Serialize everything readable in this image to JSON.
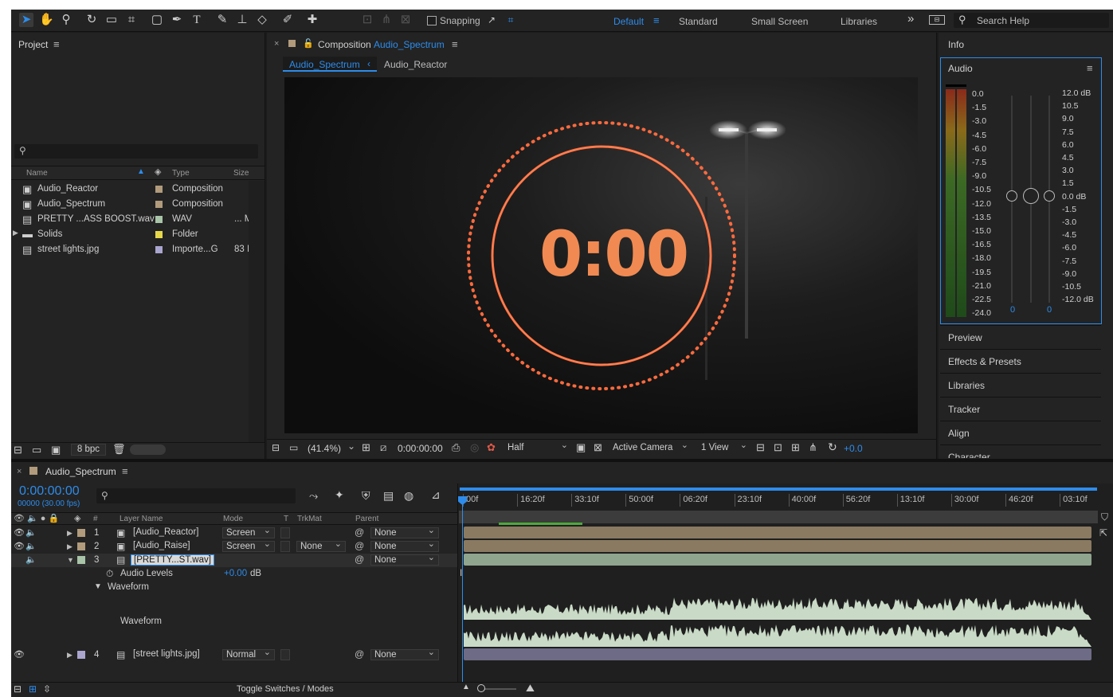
{
  "toolbar": {
    "snapping_label": "Snapping",
    "workspaces": [
      "Default",
      "Standard",
      "Small Screen",
      "Libraries"
    ],
    "active_workspace": "Default",
    "search_placeholder": "Search Help"
  },
  "project": {
    "title": "Project",
    "columns": {
      "name": "Name",
      "type": "Type",
      "size": "Size"
    },
    "items": [
      {
        "name": "Audio_Reactor",
        "type": "Composition",
        "size": "",
        "color": "#b19b7c",
        "icon": "composition-icon"
      },
      {
        "name": "Audio_Spectrum",
        "type": "Composition",
        "size": "",
        "color": "#b19b7c",
        "icon": "composition-icon"
      },
      {
        "name": "PRETTY ...ASS BOOST.wav",
        "type": "WAV",
        "size": "... M",
        "color": "#a9c4a8",
        "icon": "audio-file-icon"
      },
      {
        "name": "Solids",
        "type": "Folder",
        "size": "",
        "color": "#e6d84a",
        "icon": "folder-icon"
      },
      {
        "name": "street lights.jpg",
        "type": "Importe...G",
        "size": "83 I",
        "color": "#a9a5cf",
        "icon": "image-file-icon"
      }
    ],
    "bpc": "8 bpc"
  },
  "composition": {
    "panel_label": "Composition",
    "comp_name": "Audio_Spectrum",
    "breadcrumbs": [
      "Audio_Spectrum",
      "Audio_Reactor"
    ],
    "timer_text": "0:00",
    "zoom": "(41.4%)",
    "timecode": "0:00:00:00",
    "resolution": "Half",
    "camera": "Active Camera",
    "views": "1 View",
    "exposure": "+0.0"
  },
  "right_panel": {
    "info_label": "Info",
    "audio_label": "Audio",
    "left_scale": [
      "0.0",
      "-1.5",
      "-3.0",
      "-4.5",
      "-6.0",
      "-7.5",
      "-9.0",
      "-10.5",
      "-12.0",
      "-13.5",
      "-15.0",
      "-16.5",
      "-18.0",
      "-19.5",
      "-21.0",
      "-22.5",
      "-24.0"
    ],
    "right_scale": [
      "12.0 dB",
      "10.5",
      "9.0",
      "7.5",
      "6.0",
      "4.5",
      "3.0",
      "1.5",
      "0.0 dB",
      "-1.5",
      "-3.0",
      "-4.5",
      "-6.0",
      "-7.5",
      "-9.0",
      "-10.5",
      "-12.0 dB"
    ],
    "slider_left_value": "0",
    "slider_right_value": "0",
    "sections": [
      "Preview",
      "Effects & Presets",
      "Libraries",
      "Tracker",
      "Align",
      "Character"
    ]
  },
  "timeline": {
    "tab": "Audio_Spectrum",
    "timecode": "0:00:00:00",
    "frames": "00000 (30.00 fps)",
    "columns": {
      "num": "#",
      "layer_name": "Layer Name",
      "mode": "Mode",
      "t": "T",
      "trkmat": "TrkMat",
      "parent": "Parent"
    },
    "ruler": [
      "00f",
      "16:20f",
      "33:10f",
      "50:00f",
      "06:20f",
      "23:10f",
      "40:00f",
      "56:20f",
      "13:10f",
      "30:00f",
      "46:20f",
      "03:10f"
    ],
    "layers": [
      {
        "num": "1",
        "name": "[Audio_Reactor]",
        "mode": "Screen",
        "trkmat": "",
        "parent": "None",
        "color": "#b19b7c"
      },
      {
        "num": "2",
        "name": "[Audio_Raise]",
        "mode": "Screen",
        "trkmat": "None",
        "parent": "None",
        "color": "#b19b7c"
      },
      {
        "num": "3",
        "name": "[PRETTY...ST.wav]",
        "mode": "",
        "trkmat": "",
        "parent": "None",
        "color": "#a9c4a8"
      },
      {
        "num": "4",
        "name": "[street lights.jpg]",
        "mode": "Normal",
        "trkmat": "",
        "parent": "None",
        "color": "#a9a5cf"
      }
    ],
    "audio_levels_label": "Audio Levels",
    "audio_levels_value": "+0.00",
    "audio_levels_unit": "dB",
    "waveform_group": "Waveform",
    "waveform_label": "Waveform",
    "toggle_label": "Toggle Switches / Modes"
  }
}
